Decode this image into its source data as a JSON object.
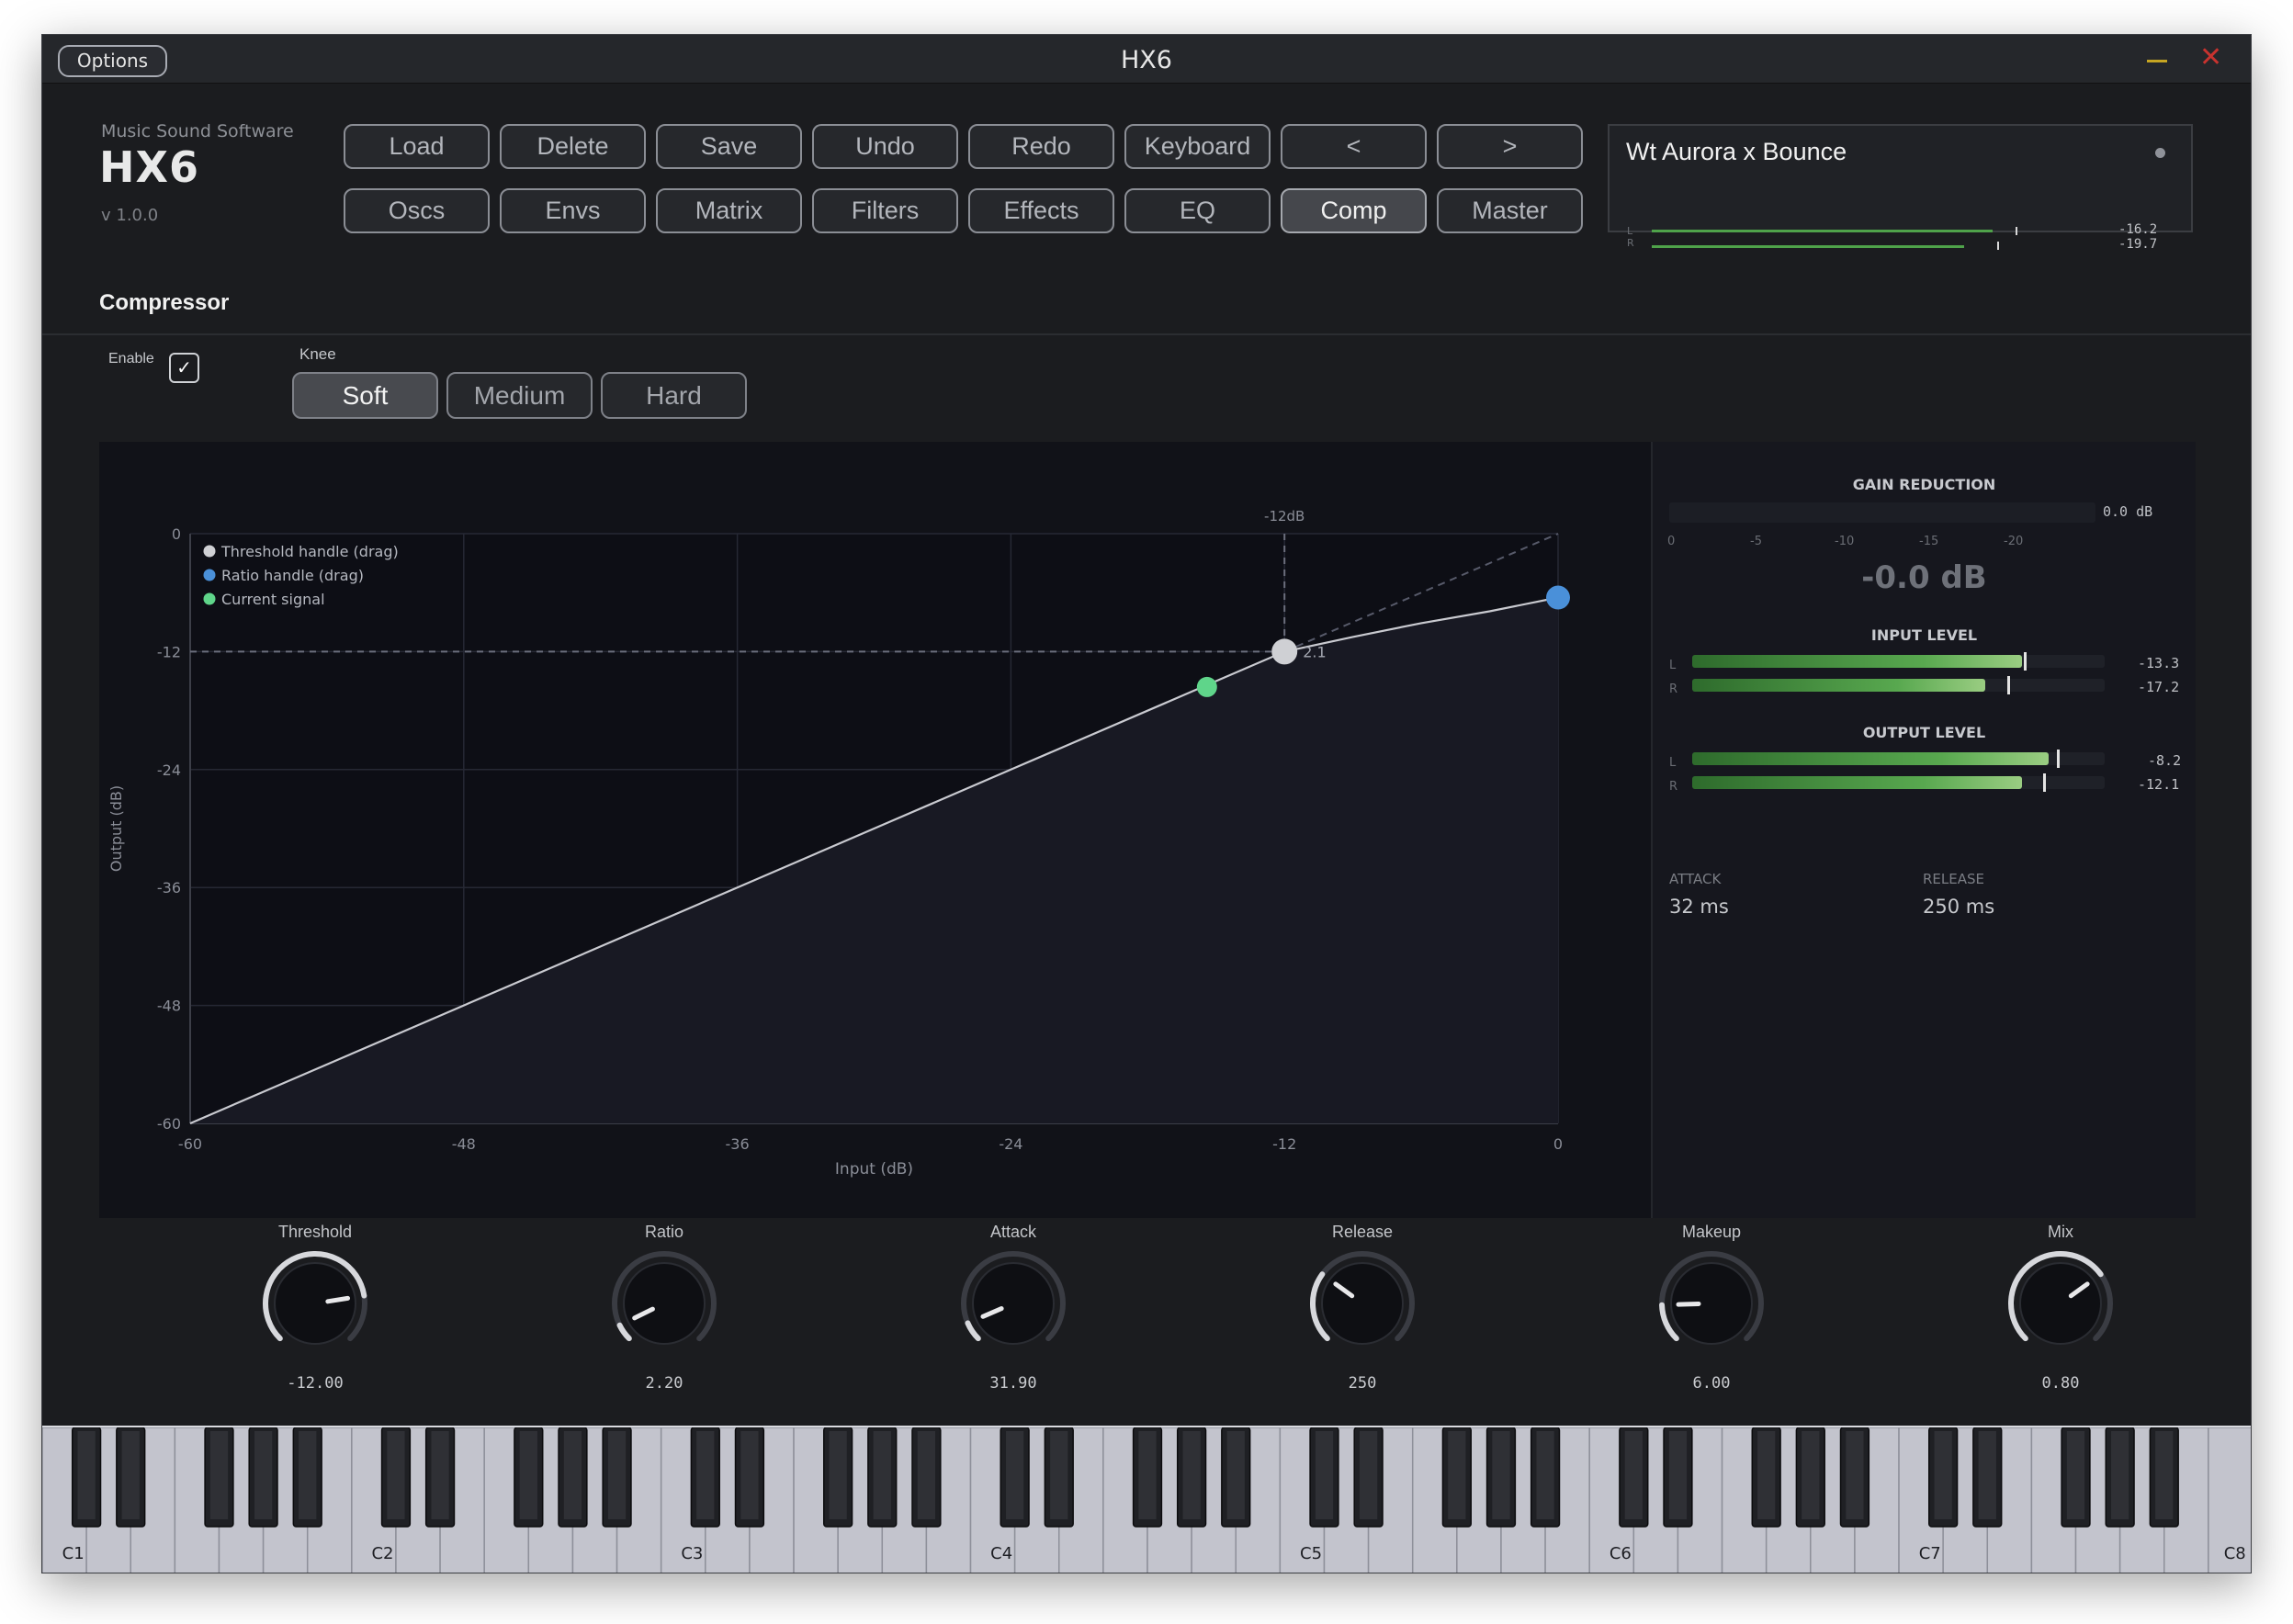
{
  "window": {
    "title": "HX6",
    "options_label": "Options"
  },
  "brand": {
    "company": "Music Sound Software",
    "logo": "HX6",
    "version": "v 1.0.0"
  },
  "nav": {
    "row1": [
      "Load",
      "Delete",
      "Save",
      "Undo",
      "Redo",
      "Keyboard",
      "<",
      ">"
    ],
    "row2": [
      "Oscs",
      "Envs",
      "Matrix",
      "Filters",
      "Effects",
      "EQ",
      "Comp",
      "Master"
    ],
    "active": "Comp"
  },
  "preset": {
    "name": "Wt Aurora x Bounce",
    "meter": {
      "left_label": "L",
      "right_label": "R",
      "left_value": "-16.2",
      "right_value": "-19.7"
    }
  },
  "section": {
    "title": "Compressor",
    "enable_label": "Enable",
    "enabled": true,
    "knee_label": "Knee"
  },
  "knee": {
    "options": [
      "Soft",
      "Medium",
      "Hard"
    ],
    "selected": "Soft"
  },
  "chart_data": {
    "type": "line",
    "xlabel": "Input (dB)",
    "ylabel": "Output (dB)",
    "xlim": [
      -60,
      0
    ],
    "ylim": [
      -60,
      0
    ],
    "x_ticks": [
      "-60",
      "-48",
      "-36",
      "-24",
      "-12",
      "0"
    ],
    "y_ticks": [
      "0",
      "-12",
      "-24",
      "-36",
      "-48",
      "-60"
    ],
    "threshold_label": "-12dB",
    "threshold_db": -12,
    "ratio_label": "2.1",
    "grid": true,
    "legend_position": "top-left",
    "legend": [
      "Threshold handle (drag)",
      "Ratio handle (drag)",
      "Current signal"
    ],
    "series": [
      {
        "name": "Transfer curve",
        "x": [
          -60,
          -48,
          -36,
          -24,
          -15.4,
          -12,
          -9,
          -6,
          -3,
          0
        ],
        "y": [
          -60,
          -48,
          -36,
          -24,
          -15.4,
          -12,
          -10.5,
          -9.1,
          -7.9,
          -6.5
        ]
      }
    ],
    "threshold_handle": {
      "x": -12,
      "y": -12
    },
    "ratio_handle": {
      "x": 0,
      "y": -6.5
    },
    "current_signal": {
      "x": -15.4,
      "y": -15.6
    },
    "colors": {
      "threshold": "#cfd0d4",
      "ratio": "#4a90d9",
      "signal": "#5fd58a",
      "curve": "#c9cad0"
    }
  },
  "meters": {
    "gain_reduction": {
      "label": "GAIN REDUCTION",
      "value_small": "0.0 dB",
      "scale": [
        "0",
        "-5",
        "-10",
        "-15",
        "-20"
      ],
      "value_big": "-0.0 dB",
      "fraction": 0.0
    },
    "input": {
      "label": "INPUT LEVEL",
      "left": {
        "label": "L",
        "value": "-13.3",
        "fraction": 0.8,
        "peak": 0.805
      },
      "right": {
        "label": "R",
        "value": "-17.2",
        "fraction": 0.71,
        "peak": 0.765
      }
    },
    "output": {
      "label": "OUTPUT LEVEL",
      "left": {
        "label": "L",
        "value": "-8.2",
        "fraction": 0.865,
        "peak": 0.885
      },
      "right": {
        "label": "R",
        "value": "-12.1",
        "fraction": 0.8,
        "peak": 0.85
      }
    },
    "attack": {
      "label": "ATTACK",
      "value": "32 ms"
    },
    "release": {
      "label": "RELEASE",
      "value": "250 ms"
    }
  },
  "knobs": [
    {
      "id": "threshold",
      "label": "Threshold",
      "value": "-12.00",
      "fraction": 0.8
    },
    {
      "id": "ratio",
      "label": "Ratio",
      "value": "2.20",
      "fraction": 0.07
    },
    {
      "id": "attack",
      "label": "Attack",
      "value": "31.90",
      "fraction": 0.08
    },
    {
      "id": "release",
      "label": "Release",
      "value": "250",
      "fraction": 0.3
    },
    {
      "id": "makeup",
      "label": "Makeup",
      "value": "6.00",
      "fraction": 0.16
    },
    {
      "id": "mix",
      "label": "Mix",
      "value": "0.80",
      "fraction": 0.7
    }
  ],
  "keyboard": {
    "octave_labels": [
      "C1",
      "C2",
      "C3",
      "C4",
      "C5",
      "C6",
      "C7",
      "C8"
    ]
  }
}
